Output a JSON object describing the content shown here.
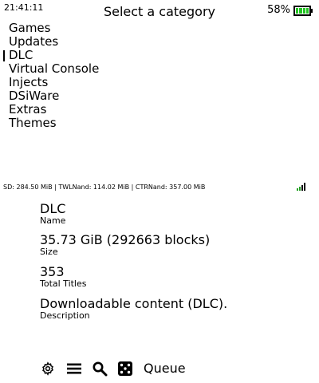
{
  "status": {
    "clock": "21:41:11",
    "battery_percent": "58%",
    "battery_level": 1.0,
    "battery_color": "#22c422"
  },
  "header": {
    "title": "Select a category"
  },
  "categories": [
    {
      "label": "Games",
      "selected": false
    },
    {
      "label": "Updates",
      "selected": false
    },
    {
      "label": "DLC",
      "selected": true
    },
    {
      "label": "Virtual Console",
      "selected": false
    },
    {
      "label": "Injects",
      "selected": false
    },
    {
      "label": "DSiWare",
      "selected": false
    },
    {
      "label": "Extras",
      "selected": false
    },
    {
      "label": "Themes",
      "selected": false
    }
  ],
  "storage": {
    "text": "SD: 284.50 MiB  |  TWLNand: 114.02 MiB  |  CTRNand: 357.00 MiB",
    "signal_icon": "wifi-signal-icon"
  },
  "details": {
    "name_value": "DLC",
    "name_label": "Name",
    "size_value": "35.73 GiB (292663 blocks)",
    "size_label": "Size",
    "titles_value": "353",
    "titles_label": "Total Titles",
    "description_value": "Downloadable content (DLC).",
    "description_label": "Description"
  },
  "toolbar": {
    "settings_icon": "gear-icon",
    "menu_icon": "hamburger-menu-icon",
    "search_icon": "search-icon",
    "random_icon": "dice-icon",
    "queue_label": "Queue"
  }
}
